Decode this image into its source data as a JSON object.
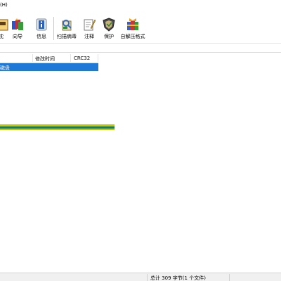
{
  "menubar": {
    "help_label": "(H)"
  },
  "toolbar": {
    "buttons": [
      {
        "label": "枕",
        "icon": "partial-icon"
      },
      {
        "label": "向导",
        "icon": "wizard-icon"
      },
      {
        "label": "信息",
        "icon": "info-icon"
      },
      {
        "label": "扫描病毒",
        "icon": "virus-scan-icon"
      },
      {
        "label": "注释",
        "icon": "comment-icon"
      },
      {
        "label": "保护",
        "icon": "shield-icon"
      },
      {
        "label": "自解压格式",
        "icon": "sfx-archive-icon"
      }
    ]
  },
  "file_list": {
    "columns": [
      "修改时间",
      "CRC32"
    ],
    "selected_row": {
      "name": "磁盘"
    },
    "progress": 1.0
  },
  "status": {
    "text": "总计 309 字节(1 个文件)"
  }
}
